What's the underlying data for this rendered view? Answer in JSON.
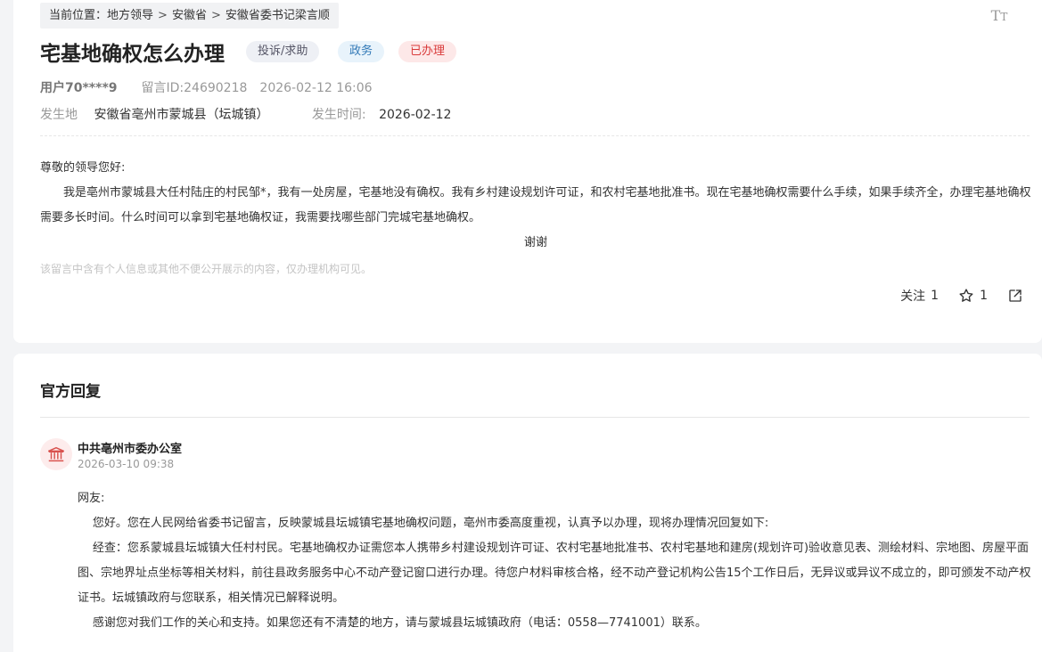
{
  "breadcrumb": {
    "prefix": "当前位置：",
    "items": [
      "地方领导",
      "安徽省",
      "安徽省委书记梁言顺"
    ],
    "separator": ">"
  },
  "font_toggle_icon": "text-size-icon",
  "message": {
    "title": "宅基地确权怎么办理",
    "tags": {
      "type": "投诉/求助",
      "domain": "政务",
      "status": "已办理"
    },
    "user": "用户70****9",
    "message_id": "留言ID:24690218",
    "datetime": "2026-02-12 16:06",
    "location_label": "发生地",
    "location": "安徽省亳州市蒙城县（坛城镇）",
    "occur_time_label": "发生时间:",
    "occur_time": "2026-02-12",
    "greeting": "尊敬的领导您好:",
    "body": "我是亳州市蒙城县大任村陆庄的村民邹*，我有一处房屋，宅基地没有确权。我有乡村建设规划许可证，和农村宅基地批准书。现在宅基地确权需要什么手续，如果手续齐全，办理宅基地确权需要多长时间。什么时间可以拿到宅基地确权证，我需要找哪些部门完城宅基地确权。",
    "thanks": "谢谢",
    "privacy_notice": "该留言中含有个人信息或其他不便公开展示的内容，仅办理机构可见。"
  },
  "actions": {
    "follow_label": "关注",
    "follow_count": "1",
    "star_count": "1",
    "star_icon": "star-icon",
    "share_icon": "share-icon"
  },
  "reply": {
    "section_title": "官方回复",
    "org_icon": "government-building-icon",
    "org_name": "中共亳州市委办公室",
    "time": "2026-03-10 09:38",
    "salutation": "网友:",
    "paragraphs": [
      "您好。您在人民网给省委书记留言，反映蒙城县坛城镇宅基地确权问题，亳州市委高度重视，认真予以办理，现将办理情况回复如下:",
      "经查：您系蒙城县坛城镇大任村村民。宅基地确权办证需您本人携带乡村建设规划许可证、农村宅基地批准书、农村宅基地和建房(规划许可)验收意见表、测绘材料、宗地图、房屋平面图、宗地界址点坐标等相关材料，前往县政务服务中心不动产登记窗口进行办理。待您户材料审核合格，经不动产登记机构公告15个工作日后，无异议或异议不成立的，即可颁发不动产权证书。坛城镇政府与您联系，相关情况已解释说明。",
      "感谢您对我们工作的关心和支持。如果您还有不清楚的地方，请与蒙城县坛城镇政府（电话：0558—7741001）联系。"
    ]
  },
  "colors": {
    "status_red": "#d93a3a",
    "domain_blue": "#3279b7",
    "page_bg": "#f3f4f6"
  }
}
